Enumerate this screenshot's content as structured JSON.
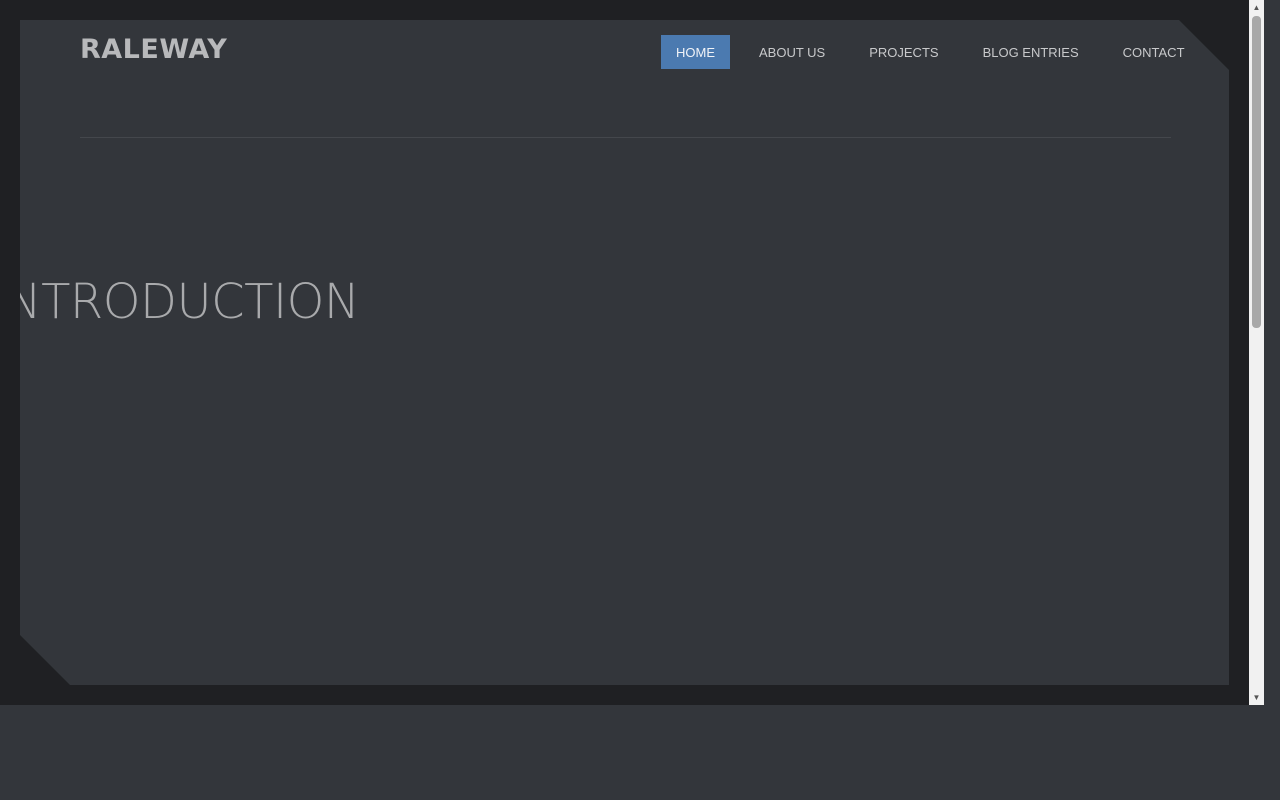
{
  "header": {
    "logo": "RALEWAY"
  },
  "nav": {
    "items": [
      {
        "label": "HOME",
        "active": true
      },
      {
        "label": "ABOUT US",
        "active": false
      },
      {
        "label": "PROJECTS",
        "active": false
      },
      {
        "label": "BLOG ENTRIES",
        "active": false
      },
      {
        "label": "CONTACT",
        "active": false
      }
    ]
  },
  "hero": {
    "heading": "INTRODUCTION"
  },
  "scrollbar": {
    "up_icon": "triangle-up-icon",
    "down_icon": "triangle-down-icon",
    "scroll_fraction": 0.0
  },
  "colors": {
    "accent": "#4b7ab0",
    "panel": "#33363b",
    "frame": "#1f2023"
  }
}
